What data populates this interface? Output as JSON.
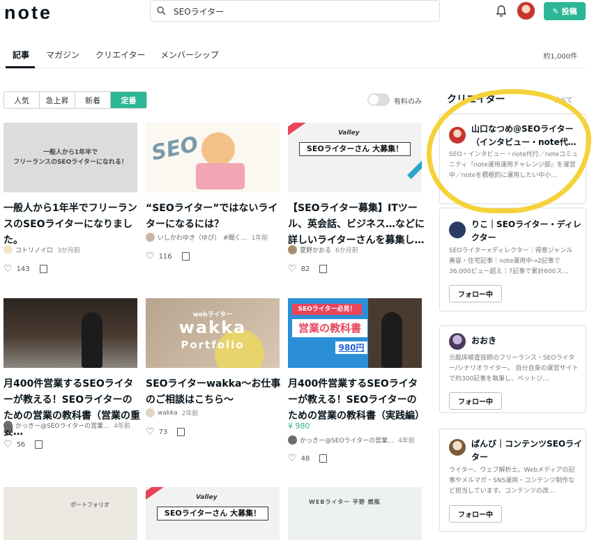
{
  "header": {
    "logo": "note",
    "search_value": "SEOライター",
    "post_label": "投稿"
  },
  "tabs": [
    {
      "label": "記事",
      "active": true
    },
    {
      "label": "マガジン"
    },
    {
      "label": "クリエイター"
    },
    {
      "label": "メンバーシップ"
    }
  ],
  "result_count": "約1,000件",
  "sort": [
    "人気",
    "急上昇",
    "新着",
    "定番"
  ],
  "paid_only_label": "有料のみ",
  "articles": [
    {
      "title": "一般人から1年半でフリーランスのSEOライターになりました。",
      "thumb_text": "一般人から1年半で\nフリーランスのSEOライターになれる！",
      "author": "コトリノイロ",
      "date": "3か月前",
      "likes": "143"
    },
    {
      "title": "“SEOライター”ではないライターになるには？",
      "thumb_text": "SEO",
      "author": "いしかわゆき（ゆぴ）",
      "tag": "#聞く…",
      "date": "1年前",
      "likes": "116"
    },
    {
      "title": "【SEOライター募集】ITツール、英会話、ビジネス…などに詳しいライターさんを募集し…",
      "thumb_text": "SEOライターさん 大募集！",
      "thumb_brand": "Valley",
      "author": "夏野かおる",
      "date": "6か月前",
      "likes": "82"
    },
    {
      "title": "月400件営業するSEOライターが教える！SEOライターのための営業の教科書（営業の重要…",
      "author": "かっきー@SEOライターの営業…",
      "date": "4年前",
      "likes": "56"
    },
    {
      "title": "SEOライターwakka～お仕事のご相談はこちら～",
      "thumb_small": "webライター",
      "thumb_text": "wakka",
      "thumb_sub": "Portfolio",
      "author": "wakka",
      "date": "2年前",
      "likes": "73"
    },
    {
      "title": "月400件営業するSEOライターが教える！SEOライターのための営業の教科書（実践編）",
      "thumb_tag": "SEOライター必見！",
      "thumb_text": "営業の教科書",
      "thumb_price": "980円",
      "price": "¥ 980",
      "author": "かっきー@SEOライターの営業…",
      "date": "4年前",
      "likes": "48"
    },
    {
      "thumb_text": "ポートフォリオ"
    },
    {
      "thumb_text": "SEOライターさん 大募集！",
      "thumb_brand": "Valley"
    },
    {
      "thumb_text": "WEBライター 平野 燃瓶"
    }
  ],
  "sidebar": {
    "title": "クリエイター",
    "see_all": "すべて",
    "follow_label": "フォロー中",
    "creators": [
      {
        "name": "山口なつめ@SEOライター（インタビュー・note代…",
        "desc": "SEO・インタビュー・note代行／noteコミュニティ『note運用運用チャレンジ部』を運営中／noteを積極的に運用したい中小…"
      },
      {
        "name": "りこ｜SEOライター・ディレクター",
        "desc": "SEOライター×ディレクター｜得意ジャンル美容・住宅記事｜note運用中→2記事で36,000ビュー超え｜7記事で累計600ス…"
      },
      {
        "name": "おおき",
        "desc": "元臨床検査技師のフリーランス・SEOライター/シナリオライター。 自分自身の運営サイトで約300記事を執筆し、ベットジ…"
      },
      {
        "name": "ぱんび｜コンテンツSEOライター",
        "desc": "ライター、ウェブ解析士。Webメディアの記事やメルマガ・SNS運用・コンテンツ制作など担当しています。コンテンツの改…"
      }
    ]
  },
  "colors": {
    "accent": "#2cb696",
    "highlight": "#f5d23a"
  }
}
